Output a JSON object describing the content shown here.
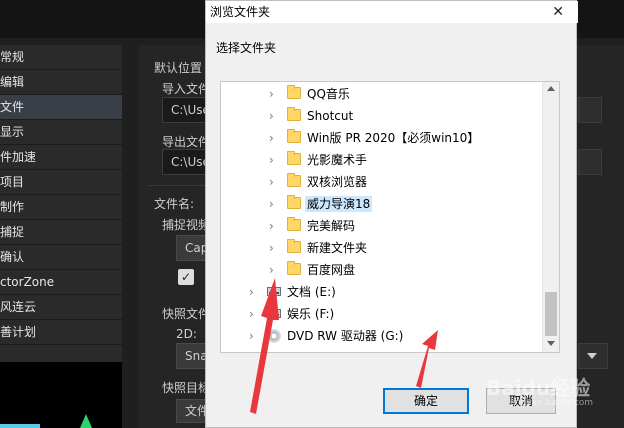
{
  "sidebar": {
    "items": [
      {
        "label": "常规",
        "active": false
      },
      {
        "label": "编辑",
        "active": false
      },
      {
        "label": "文件",
        "active": true
      },
      {
        "label": "显示",
        "active": false
      },
      {
        "label": "件加速",
        "active": false
      },
      {
        "label": "项目",
        "active": false
      },
      {
        "label": "制作",
        "active": false
      },
      {
        "label": "捕捉",
        "active": false
      },
      {
        "label": "确认",
        "active": false
      },
      {
        "label": "ctorZone",
        "active": false
      },
      {
        "label": "风连云",
        "active": false
      },
      {
        "label": "善计划",
        "active": false
      }
    ]
  },
  "settings": {
    "default_location_label": "默认位置",
    "import_label": "导入文件",
    "import_value": "C:\\Use",
    "export_label": "导出文件",
    "export_value": "C:\\Use",
    "filename_label": "文件名:",
    "capture_label": "捕捉视频",
    "capture_value": "Cap",
    "checkbox_mark": "✓",
    "snapshot_label": "快照文件",
    "snapshot_2d_label": "2D:",
    "snapshot_value": "Sna",
    "snapshot_target_label": "快照目标",
    "snapshot_target_button": "文件"
  },
  "dialog": {
    "title": "浏览文件夹",
    "close_glyph": "✕",
    "prompt": "选择文件夹",
    "ok_label": "确定",
    "cancel_label": "取消",
    "tree": [
      {
        "label": "QQ音乐",
        "type": "folder",
        "selected": false
      },
      {
        "label": "Shotcut",
        "type": "folder",
        "selected": false
      },
      {
        "label": "Win版 PR 2020【必须win10】",
        "type": "folder",
        "selected": false
      },
      {
        "label": "光影魔术手",
        "type": "folder",
        "selected": false
      },
      {
        "label": "双核浏览器",
        "type": "folder",
        "selected": false
      },
      {
        "label": "威力导演18",
        "type": "folder",
        "selected": true
      },
      {
        "label": "完美解码",
        "type": "folder",
        "selected": false
      },
      {
        "label": "新建文件夹",
        "type": "folder",
        "selected": false
      },
      {
        "label": "百度网盘",
        "type": "folder",
        "selected": false
      },
      {
        "label": "文档 (E:)",
        "type": "drive",
        "selected": false
      },
      {
        "label": "娱乐 (F:)",
        "type": "drive",
        "selected": false
      },
      {
        "label": "DVD RW 驱动器 (G:)",
        "type": "disc",
        "selected": false
      }
    ]
  },
  "watermark": {
    "brand": "Baidu经验",
    "url": "jingyan.baidu.com"
  },
  "colors": {
    "annotation_arrow": "#e8383d",
    "selection": "#cce8ff",
    "ok_border": "#0078d7"
  }
}
